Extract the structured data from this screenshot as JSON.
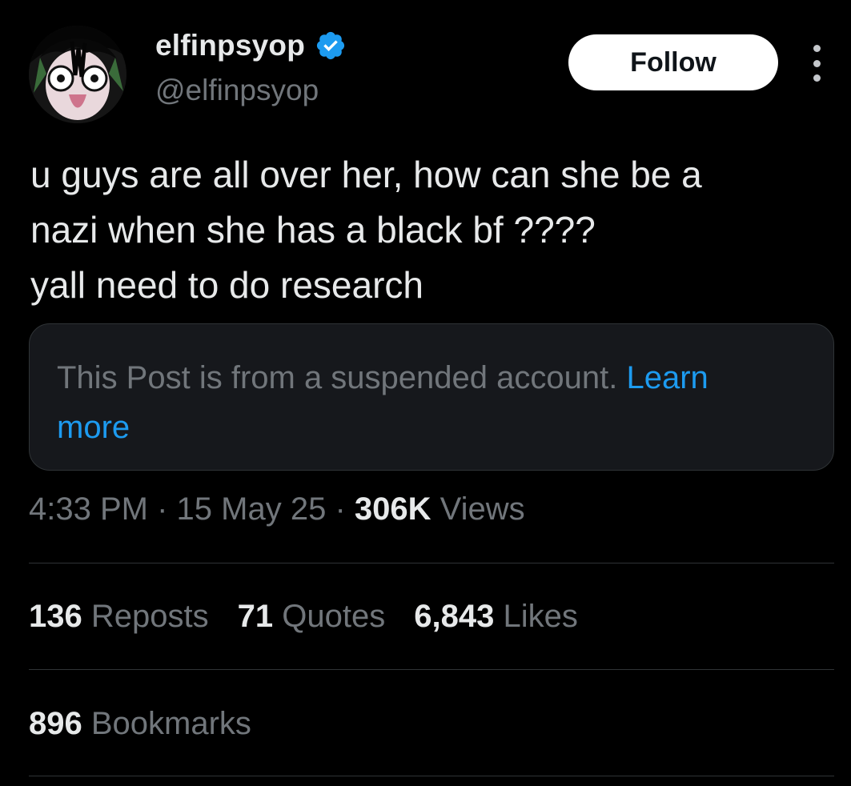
{
  "author": {
    "display_name": "elfinpsyop",
    "handle": "@elfinpsyop",
    "verified": true
  },
  "follow_button": {
    "label": "Follow"
  },
  "tweet": {
    "lines": [
      "u guys are all over her, how can she be a",
      "nazi when she has a black bf ????",
      "yall need to do research"
    ]
  },
  "notice": {
    "text": "This Post is from a suspended account. ",
    "link_first": "Learn",
    "link_second": "more"
  },
  "meta": {
    "time": "4:33 PM",
    "separator": "·",
    "date": "15 May 25",
    "views_count": "306K",
    "views_label": "Views"
  },
  "stats": {
    "reposts_count": "136",
    "reposts_label": "Reposts",
    "quotes_count": "71",
    "quotes_label": "Quotes",
    "likes_count": "6,843",
    "likes_label": "Likes",
    "bookmarks_count": "896",
    "bookmarks_label": "Bookmarks"
  },
  "colors": {
    "background": "#000000",
    "text_primary": "#e7e9ea",
    "text_secondary": "#71767b",
    "link": "#1d9bf0",
    "verified": "#1d9bf0",
    "divider": "#2f3336"
  },
  "icons": {
    "verified": "verified-badge-icon",
    "more": "more-options-icon"
  }
}
